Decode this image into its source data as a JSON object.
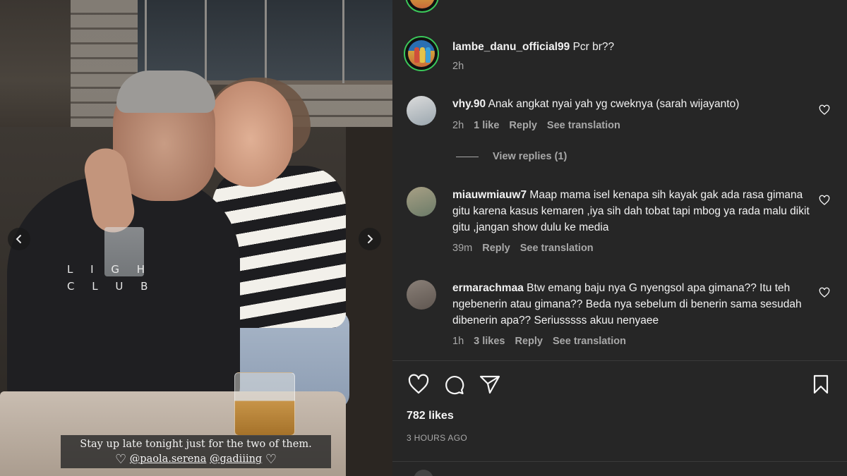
{
  "photo": {
    "shirt_text": "L I G H\nC L U B",
    "caption_line1": "Stay up late tonight just for the two of them.",
    "caption_mention1": "@paola.serena",
    "caption_mention2": "@gadiiing",
    "caption_heart": "♡",
    "prev_icon": "chevron-left-icon",
    "next_icon": "chevron-right-icon"
  },
  "post": {
    "author": "lambe_danu_official99",
    "caption": "Pcr br??",
    "time": "2h"
  },
  "comments": [
    {
      "username": "vhy.90",
      "text": "Anak angkat nyai yah yg cweknya (sarah wijayanto)",
      "time": "2h",
      "likes": "1 like",
      "reply": "Reply",
      "translate": "See translation",
      "view_replies": "View replies (1)"
    },
    {
      "username": "miauwmiauw7",
      "text": "Maap mama isel kenapa sih kayak gak ada rasa gimana gitu karena kasus kemaren ,iya sih dah tobat tapi mbog ya rada malu dikit gitu ,jangan show dulu ke media",
      "time": "39m",
      "reply": "Reply",
      "translate": "See translation"
    },
    {
      "username": "ermarachmaa",
      "text": "Btw emang baju nya G nyengsol apa gimana?? Itu teh ngebenerin atau gimana?? Beda nya sebelum di benerin sama sesudah dibenerin apa?? Seriusssss akuu nenyaee",
      "time": "1h",
      "likes": "3 likes",
      "reply": "Reply",
      "translate": "See translation"
    }
  ],
  "actions": {
    "like_icon": "heart-icon",
    "comment_icon": "comment-icon",
    "share_icon": "send-icon",
    "save_icon": "bookmark-icon"
  },
  "stats": {
    "likes": "782 likes",
    "posted": "3 HOURS AGO"
  },
  "colors": {
    "panel_bg": "#262626",
    "text": "#f5f5f5",
    "muted": "#a8a8a8",
    "story_ring": "#3bc85a"
  }
}
